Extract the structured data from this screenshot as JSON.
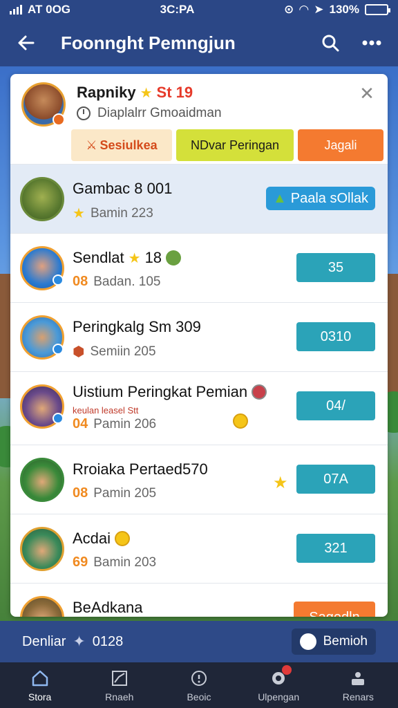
{
  "status_bar": {
    "carrier": "AT 0OG",
    "center": "3C:PA",
    "battery_text": "130%"
  },
  "app_bar": {
    "title": "Foonnght Pemngjun"
  },
  "card_header": {
    "name": "Rapniky",
    "score": "St 19",
    "subtitle": "Diaplalrr Gmoaidman",
    "tabs": [
      {
        "label": "Sesiulkea"
      },
      {
        "label": "NDvar Peringan"
      },
      {
        "label": "Jagali"
      }
    ]
  },
  "rows": [
    {
      "name": "Gambac 8 001",
      "rank": "",
      "sub": "Bamin 223",
      "action": "Paala sOllak",
      "extra": ""
    },
    {
      "name": "Sendlat",
      "name_score": "18",
      "rank": "08",
      "sub": "Badan. 105",
      "action": "35",
      "extra": ""
    },
    {
      "name": "Peringkalg Sm 309",
      "rank": "",
      "sub": "Semiin 205",
      "action": "0310",
      "extra": ""
    },
    {
      "name": "Uistium Peringkat Pemian",
      "rank": "04",
      "sub": "Pamin 206",
      "action": "04/",
      "extra": "keulan leasel Stt"
    },
    {
      "name": "Rroiaka Pertaed570",
      "rank": "08",
      "sub": "Pamin 205",
      "action": "07A",
      "extra": ""
    },
    {
      "name": "Acdai",
      "rank": "69",
      "sub": "Bamin 203",
      "action": "321",
      "extra": ""
    },
    {
      "name": "BeAdkana",
      "rank": "",
      "sub": "",
      "action": "Sagedln",
      "extra": ""
    }
  ],
  "bottom_strip": {
    "left_label": "Denliar",
    "left_value": "0128",
    "button_label": "Bemioh"
  },
  "bottom_nav": [
    {
      "label": "Stora"
    },
    {
      "label": "Rnaeh"
    },
    {
      "label": "Beoic"
    },
    {
      "label": "Ulpengan"
    },
    {
      "label": "Renars"
    }
  ],
  "colors": {
    "app_bar": "#2b4786",
    "action_teal": "#2ba3b8",
    "action_orange": "#f47a30",
    "rank_orange": "#f08a20",
    "score_red": "#e63a2a"
  }
}
